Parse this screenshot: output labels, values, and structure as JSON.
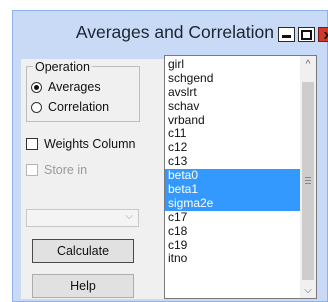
{
  "window": {
    "title": "Averages and Correlation",
    "controls": {
      "minimize_icon": "minimize-icon",
      "maximize_icon": "maximize-icon",
      "close_icon": "close-icon",
      "close_glyph": "x"
    }
  },
  "operation": {
    "legend": "Operation",
    "options": [
      {
        "label": "Averages",
        "selected": true
      },
      {
        "label": "Correlation",
        "selected": false
      }
    ]
  },
  "weights_column": {
    "label": "Weights Column",
    "checked": false
  },
  "store_in": {
    "label": "Store in",
    "checked": false,
    "enabled": false
  },
  "store_combo": {
    "value": "",
    "arrow": "⌵"
  },
  "buttons": {
    "calculate": "Calculate",
    "help": "Help"
  },
  "variable_list": {
    "items": [
      {
        "label": "girl",
        "selected": false
      },
      {
        "label": "schgend",
        "selected": false
      },
      {
        "label": "avslrt",
        "selected": false
      },
      {
        "label": "schav",
        "selected": false
      },
      {
        "label": "vrband",
        "selected": false
      },
      {
        "label": "c11",
        "selected": false
      },
      {
        "label": "c12",
        "selected": false
      },
      {
        "label": "c13",
        "selected": false
      },
      {
        "label": "beta0",
        "selected": true
      },
      {
        "label": "beta1",
        "selected": true
      },
      {
        "label": "sigma2e",
        "selected": true
      },
      {
        "label": "c17",
        "selected": false
      },
      {
        "label": "c18",
        "selected": false
      },
      {
        "label": "c19",
        "selected": false
      },
      {
        "label": "itno",
        "selected": false
      },
      {
        "label": "",
        "selected": false
      }
    ],
    "scroll_up": "^",
    "scroll_down": "⌵",
    "selection_color": "#3399ff"
  }
}
